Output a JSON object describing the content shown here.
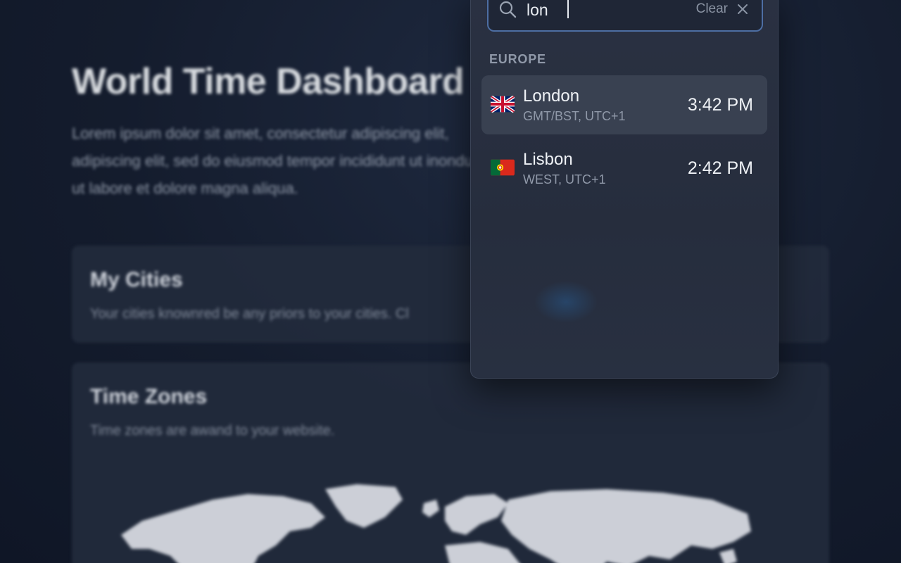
{
  "background": {
    "title": "World Time Dashboard",
    "description": "Lorem ipsum dolor sit amet, consectetur adipiscing elit, adipiscing elit, sed do eiusmod tempor incididunt ut inondunt ut labore et dolore magna aliqua.",
    "cards": {
      "cities": {
        "title": "My Cities",
        "subtitle": "Your cities knownred be any priors to your cities. Cl"
      },
      "zones": {
        "title": "Time Zones",
        "subtitle": "Time zones are awand to your website."
      }
    }
  },
  "search": {
    "value": "lon",
    "clear_label": "Clear"
  },
  "results": {
    "group_label": "EUROPE",
    "items": [
      {
        "city": "London",
        "timezone": "GMT/BST, UTC+1",
        "time": "3:42 PM",
        "flag": "uk-flag-icon",
        "active": true
      },
      {
        "city": "Lisbon",
        "timezone": "WEST, UTC+1",
        "time": "2:42 PM",
        "flag": "portugal-flag-icon",
        "active": false
      }
    ]
  },
  "colors": {
    "accent": "#4d6ea3",
    "panel": "#2a3142",
    "highlight": "#394151"
  }
}
